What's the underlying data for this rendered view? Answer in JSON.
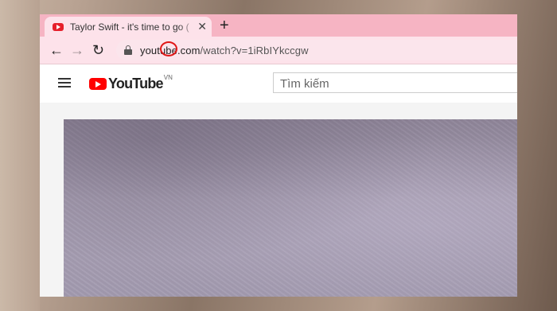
{
  "browser": {
    "tab": {
      "title": "Taylor Swift - it's time to go (",
      "close_glyph": "✕"
    },
    "new_tab_glyph": "+",
    "nav": {
      "back": "←",
      "forward": "→",
      "reload": "↻"
    },
    "url": {
      "host": "youtube.com",
      "path": "/watch?v=1iRbIYkccgw"
    }
  },
  "youtube": {
    "logo_text": "YouTube",
    "region": "VN",
    "search_placeholder": "Tìm kiếm"
  },
  "colors": {
    "tabbar": "#f6b4c3",
    "toolbar": "#fde2ea",
    "youtube_red": "#ff0000",
    "annotation_ring": "#e01818"
  }
}
